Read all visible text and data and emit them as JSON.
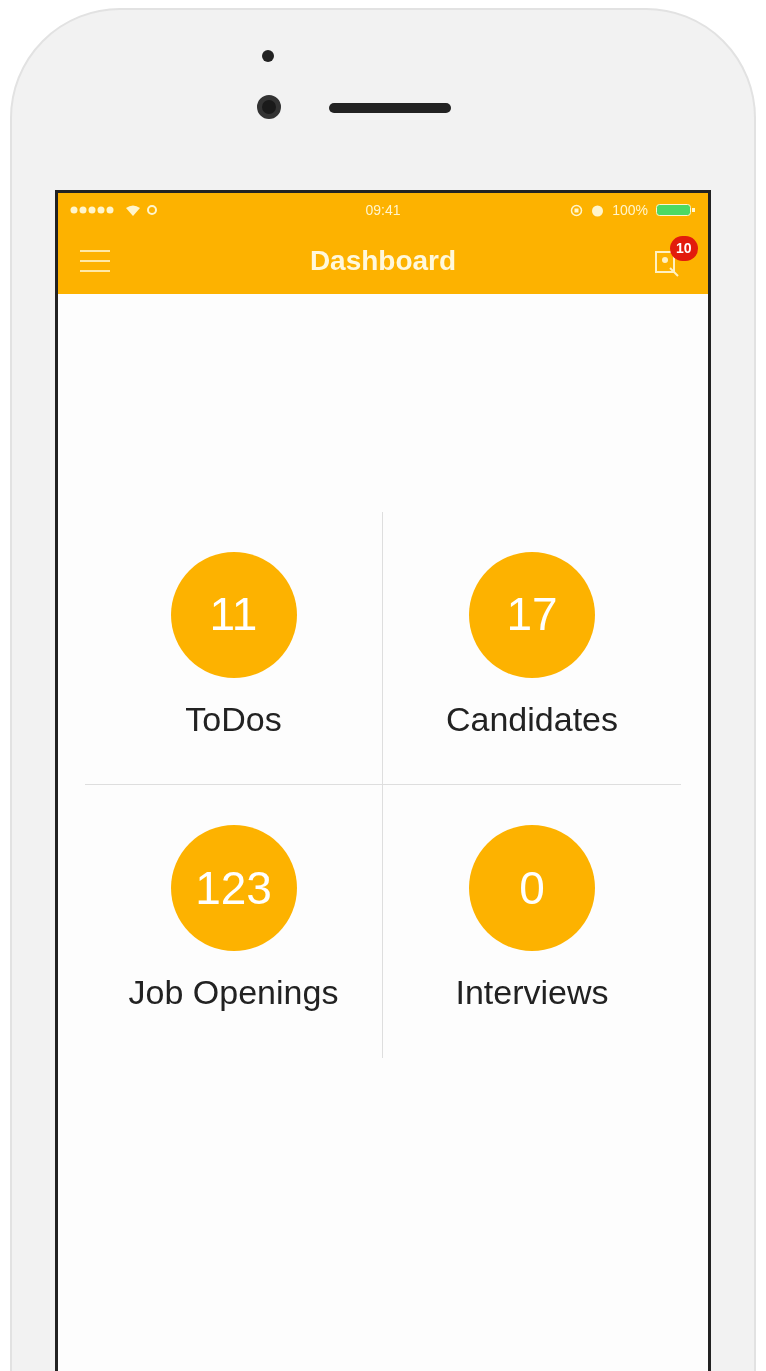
{
  "status_bar": {
    "time": "09:41",
    "battery_text": "100%"
  },
  "header": {
    "title": "Dashboard",
    "notification_count": "10"
  },
  "tiles": [
    {
      "count": "11",
      "label": "ToDos"
    },
    {
      "count": "17",
      "label": "Candidates"
    },
    {
      "count": "123",
      "label": "Job Openings"
    },
    {
      "count": "0",
      "label": "Interviews"
    }
  ]
}
